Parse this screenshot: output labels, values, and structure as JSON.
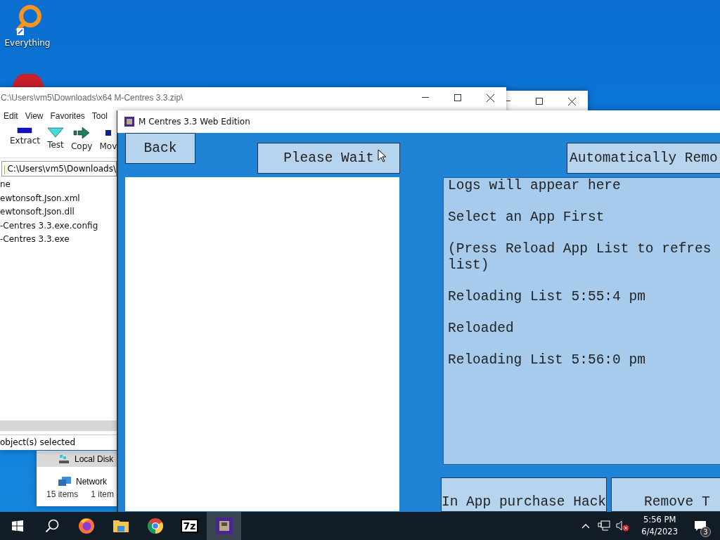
{
  "desktop_icons": [
    {
      "label": "Everything"
    }
  ],
  "zip_window": {
    "title": "C:\\Users\\vm5\\Downloads\\x64 M-Centres 3.3.zip\\",
    "menu": [
      "Edit",
      "View",
      "Favorites",
      "Tool"
    ],
    "toolbar": [
      {
        "kind": "extract",
        "label": "Extract"
      },
      {
        "kind": "test",
        "label": "Test"
      },
      {
        "kind": "copy",
        "label": "Copy"
      },
      {
        "kind": "move",
        "label": "Mov"
      }
    ],
    "address": "C:\\Users\\vm5\\Downloads\\",
    "list_header": "ne",
    "files": [
      "ewtonsoft.Json.xml",
      "ewtonsoft.Json.dll",
      "-Centres 3.3.exe.config",
      "-Centres 3.3.exe"
    ],
    "status": "object(s) selected"
  },
  "explorer_window": {
    "items": [
      {
        "kind": "drive",
        "label": "Local Disk",
        "selected": true
      },
      {
        "kind": "network",
        "label": "Network",
        "selected": false
      }
    ],
    "status": [
      "15 items",
      "1 item"
    ]
  },
  "app_window": {
    "title": "M Centres 3.3 Web Edition",
    "back": "Back",
    "wait": "Please Wait",
    "auto": "Automatically Remo",
    "log": [
      [
        "Logs will appear here"
      ],
      [
        "Select an App First"
      ],
      [
        "(Press Reload App List to refres",
        "list)"
      ],
      [
        "Reloading List 5:55:4 pm"
      ],
      [
        "Reloaded"
      ],
      [
        "Reloading List 5:56:0 pm"
      ]
    ],
    "bottom_buttons": [
      "In App purchase Hack",
      "Remove T"
    ]
  },
  "taskbar": {
    "apps": [
      {
        "kind": "firefox",
        "active": false
      },
      {
        "kind": "folder",
        "active": false
      },
      {
        "kind": "chrome",
        "active": false
      },
      {
        "kind": "sevenzip",
        "label": "7z",
        "active": false
      },
      {
        "kind": "app",
        "active": true
      }
    ],
    "time": "5:56 PM",
    "date": "6/4/2023",
    "notifications": "3"
  }
}
